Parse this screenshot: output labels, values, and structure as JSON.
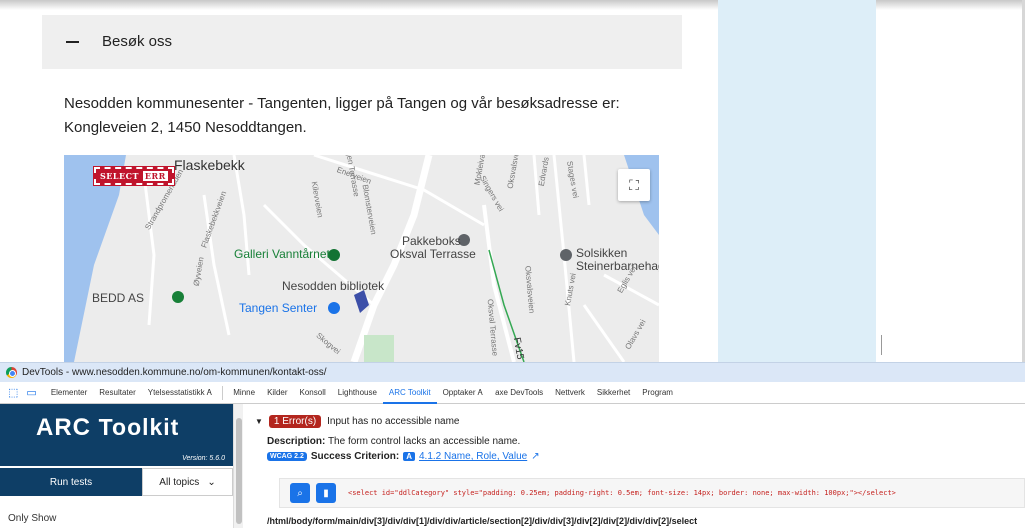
{
  "page": {
    "accordion_label": "Besøk oss",
    "info_text_line1": "Nesodden kommunesenter - Tangenten, ligger på Tangen og vår besøksadresse er:",
    "info_text_line2": "Kongleveien 2, 1450 Nesoddtangen."
  },
  "map": {
    "labels": {
      "flaskebekk": "Flaskebekk",
      "galleri": "Galleri Vanntårnet",
      "pakkeboks1": "Pakkeboks",
      "pakkeboks2": "Oksval Terrasse",
      "solsikken1": "Solsikken",
      "solsikken2": "Steinerbarnehage",
      "bibliotek": "Nesodden bibliotek",
      "bedd": "BEDD AS",
      "tangen": "Tangen Senter",
      "fv": "Fv15",
      "enerveien": "Enerveien",
      "strandpromenaden": "Strandpromenaden",
      "flaskebekkveien": "Flaskebekkveien",
      "kilevveien": "Kilevveien",
      "blomsterveien": "Blomsterveien",
      "tangen_terrasse": "Tangen Terrasse",
      "mokleiva": "Mokleiva",
      "okvalsvn": "Oksvalsvei",
      "edvards": "Edvards vei",
      "stages": "Stages vei",
      "singers": "Singers vei",
      "okvalsveien": "Oksvalsveien",
      "oksval_terrasse": "Oksval Terrasse",
      "knuts": "Knuts vei",
      "eglis": "Eglis vei",
      "olavs": "Olavs vei",
      "oyveien": "Øyveien",
      "skogvei": "Skogvei"
    },
    "select_badge": "SELECT",
    "err_badge": "ERR"
  },
  "devtools": {
    "window_title": "DevTools - www.nesodden.kommune.no/om-kommunen/kontakt-oss/",
    "tabs": [
      "Elementer",
      "Resultater",
      "Ytelsesstatistikk Ꭺ",
      "Minne",
      "Kilder",
      "Konsoll",
      "Lighthouse",
      "ARC Toolkit",
      "Opptaker Ꭺ",
      "axe DevTools",
      "Nettverk",
      "Sikkerhet",
      "Program"
    ],
    "active_tab": "ARC Toolkit"
  },
  "arc": {
    "logo_arc": "ARC",
    "logo_toolkit": "Toolkit",
    "version": "Version: 5.6.0",
    "run_tests": "Run tests",
    "topics": "All topics",
    "only_show": "Only Show"
  },
  "result": {
    "error_count": "1",
    "error_label": "Error(s)",
    "title": "Input has no accessible name",
    "desc_label": "Description:",
    "desc_text": "The form control lacks an accessible name.",
    "wcag_pill": "WCAG 2.2",
    "sc_label": "Success Criterion:",
    "sc_level": "A",
    "sc_link": "4.1.2 Name, Role, Value",
    "code": "<select id=\"ddlCategory\" style=\"padding: 0.25em; padding-right: 0.5em; font-size: 14px; border: none; max-width: 100px;\"></select>",
    "xpath": "/html/body/form/main/div[3]/div/div[1]/div/div/article/section[2]/div/div[3]/div[2]/div[2]/div/div[2]/select"
  },
  "colors": {
    "arc_navy": "#0e3e66",
    "accent_blue": "#1a73e8",
    "error_red": "#b3261e",
    "sidebar_blue": "#ddeef8"
  }
}
